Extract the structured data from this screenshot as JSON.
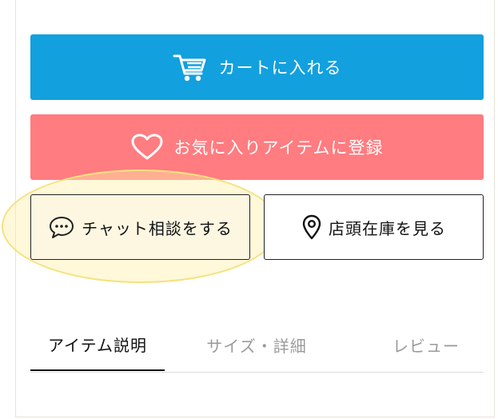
{
  "actions": {
    "cart_label": "カートに入れる",
    "favorite_label": "お気に入りアイテムに登録",
    "chat_label": "チャット相談をする",
    "store_stock_label": "店頭在庫を見る"
  },
  "tabs": [
    {
      "label": "アイテム説明",
      "active": true
    },
    {
      "label": "サイズ・詳細",
      "active": false
    },
    {
      "label": "レビュー",
      "active": false
    }
  ],
  "colors": {
    "cart_button": "#12a0de",
    "favorite_button": "#ff7c80",
    "chat_button_bg": "#fdf7e2",
    "highlight": "#f6e17e"
  },
  "icons": {
    "cart": "cart-icon",
    "favorite": "heart-icon",
    "chat": "chat-bubble-icon",
    "store": "map-pin-icon"
  }
}
